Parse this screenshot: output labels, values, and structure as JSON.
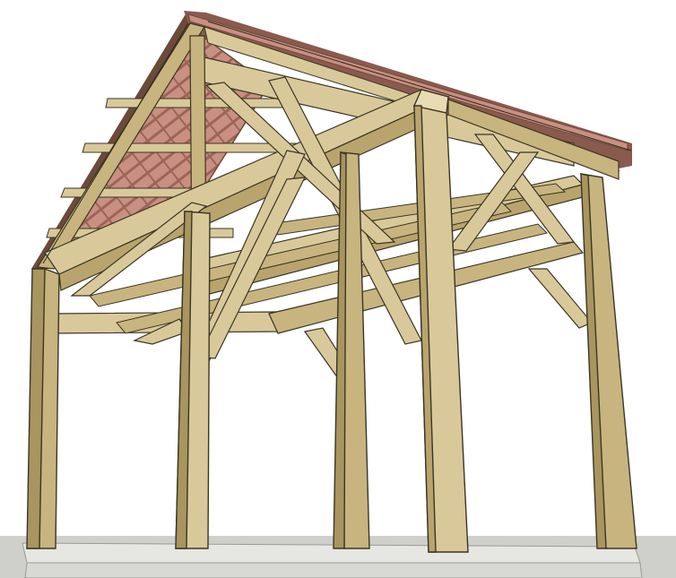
{
  "scene": {
    "subject": "timber-frame-pavilion",
    "colors": {
      "background": "#ffffff",
      "ground": "#cfcfcc",
      "slab_top": "#e4e4e2",
      "slab_front": "#d9d9d6",
      "timber_light": "#d9c99a",
      "timber_mid": "#c8b47f",
      "timber_dark": "#a8955f",
      "timber_edge": "#3b3524",
      "shingle": "#c98f82",
      "shingle_dark": "#8a5a4e",
      "roof_edge": "#6b4a3a"
    }
  }
}
